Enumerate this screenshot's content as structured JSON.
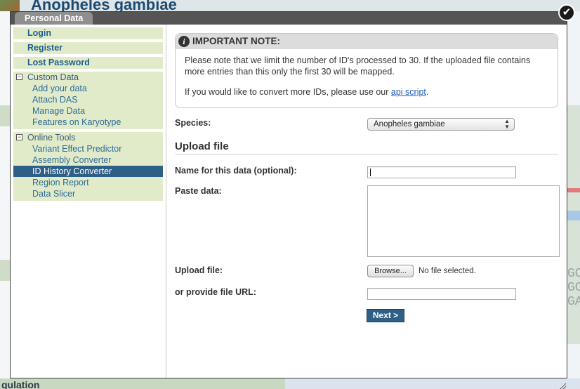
{
  "background": {
    "page_title": "Anopheles gambiae",
    "bottom_heading": "gulation",
    "right_letters": "GC GC GA"
  },
  "modal": {
    "tab_label": "Personal Data",
    "close_symbol": "✔"
  },
  "sidebar": {
    "links": [
      {
        "label": "Login"
      },
      {
        "label": "Register"
      },
      {
        "label": "Lost Password"
      }
    ],
    "groups": [
      {
        "title": "Custom Data",
        "toggle": "−",
        "items": [
          "Add your data",
          "Attach DAS",
          "Manage Data",
          "Features on Karyotype"
        ]
      },
      {
        "title": "Online Tools",
        "toggle": "−",
        "items": [
          "Variant Effect Predictor",
          "Assembly Converter",
          "ID History Converter",
          "Region Report",
          "Data Slicer"
        ]
      }
    ],
    "active_item": "ID History Converter"
  },
  "note": {
    "icon": "info-icon",
    "title": "IMPORTANT NOTE:",
    "line1": "Please note that we limit the number of ID's processed to 30. If the uploaded file contains more entries than this only the first 30 will be mapped.",
    "line2_prefix": "If you would like to convert more IDs, please use our ",
    "line2_link": "api script",
    "line2_suffix": "."
  },
  "form": {
    "species_label": "Species:",
    "species_value": "Anopheles gambiae",
    "section_title": "Upload file",
    "name_label": "Name for this data (optional):",
    "name_value": "",
    "paste_label": "Paste data:",
    "upload_label": "Upload file:",
    "browse_label": "Browse...",
    "file_status": "No file selected.",
    "url_label": "or provide file URL:",
    "url_value": "",
    "next_label": "Next >"
  },
  "colors": {
    "sidebar_bg": "#e1ebc9",
    "active_bg": "#2e6087",
    "link_color": "#1f5f8e",
    "modal_frame": "#555555"
  }
}
